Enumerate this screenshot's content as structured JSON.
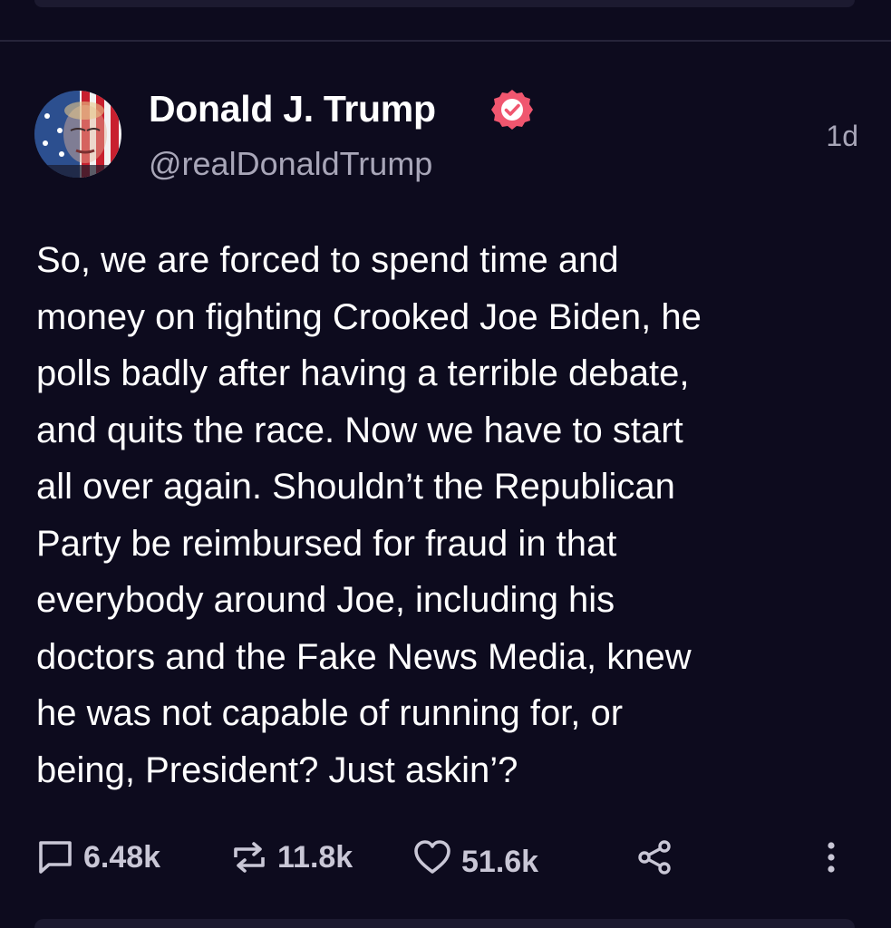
{
  "post": {
    "author_name": "Donald J. Trump",
    "handle": "@realDonaldTrump",
    "timestamp": "1d",
    "text": "So, we are forced to spend time and\nmoney on fighting Crooked Joe Biden, he\npolls badly after having a terrible debate,\nand quits the race. Now we have to start\nall over again. Shouldn’t the Republican\nParty be reimbursed for fraud in that\neverybody around Joe, including his\ndoctors and the Fake News Media, knew\nhe was not capable of running for, or\nbeing, President? Just askin’?",
    "verified": true,
    "badge_color": "#f0566f"
  },
  "actions": {
    "replies": {
      "icon": "comment-icon",
      "count": "6.48k"
    },
    "reposts": {
      "icon": "repost-icon",
      "count": "11.8k"
    },
    "likes": {
      "icon": "heart-icon",
      "count": "51.6k"
    },
    "share": {
      "icon": "share-icon"
    },
    "more": {
      "icon": "more-vertical-icon"
    }
  },
  "colors": {
    "background": "#0d0b1e",
    "text_primary": "#ffffff",
    "text_secondary": "#a8a6b8",
    "action_color": "#c9c7d6"
  }
}
